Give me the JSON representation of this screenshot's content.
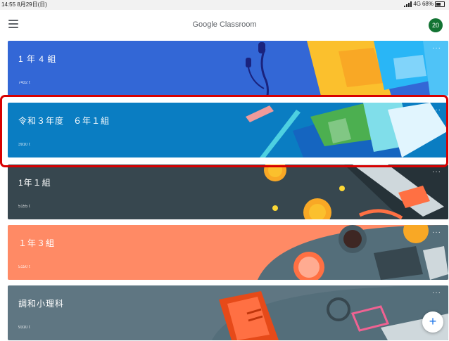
{
  "status_bar": {
    "time_date": "14:55  8月29日(日)",
    "network": "4G",
    "battery": "68%"
  },
  "app_bar": {
    "title": "Google Classroom",
    "avatar_text": "20"
  },
  "classes": [
    {
      "name": "1 年 4 組",
      "code": "7432 t",
      "color": "#3367d6",
      "more": "···"
    },
    {
      "name": "令和３年度　６年１組",
      "code": "3910 t",
      "color": "#0a7dc2",
      "more": "···"
    },
    {
      "name": "1年１組",
      "code": "5155 t",
      "color": "#37474f",
      "more": "···"
    },
    {
      "name": "１年３組",
      "code": "5150 t",
      "color": "#ff8a65",
      "more": "···"
    },
    {
      "name": "調和小理科",
      "code": "9310 t",
      "color": "#5f7682",
      "more": "···"
    }
  ],
  "fab": {
    "label": "+"
  },
  "colors": {
    "highlight": "#d80000",
    "avatar": "#137333",
    "fab_plus": "#1a73e8"
  }
}
